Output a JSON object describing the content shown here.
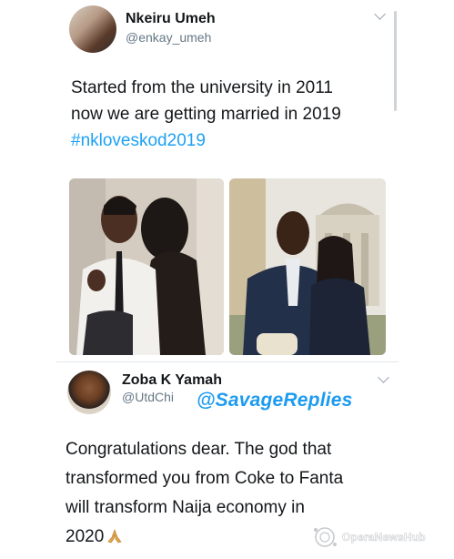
{
  "tweet": {
    "author_name": "Nkeiru Umeh",
    "author_handle": "@enkay_umeh",
    "text_line1": "Started from the university in 2011",
    "text_line2": "now we are getting married in 2019",
    "hashtag": "#nkloveskod2019"
  },
  "reply": {
    "author_name": "Zoba K Yamah",
    "author_handle": "@UtdChi",
    "tag": "@SavageReplies",
    "text_line1": "Congratulations dear. The god that",
    "text_line2": "transformed you from Coke to Fanta",
    "text_line3": "will transform Naija economy in",
    "text_line4": "2020",
    "emoji": "praying-hands-emoji"
  },
  "watermark": {
    "text": "OperaNewsHub"
  },
  "colors": {
    "link": "#1da1f2",
    "handle": "#657786",
    "text": "#14171a"
  }
}
